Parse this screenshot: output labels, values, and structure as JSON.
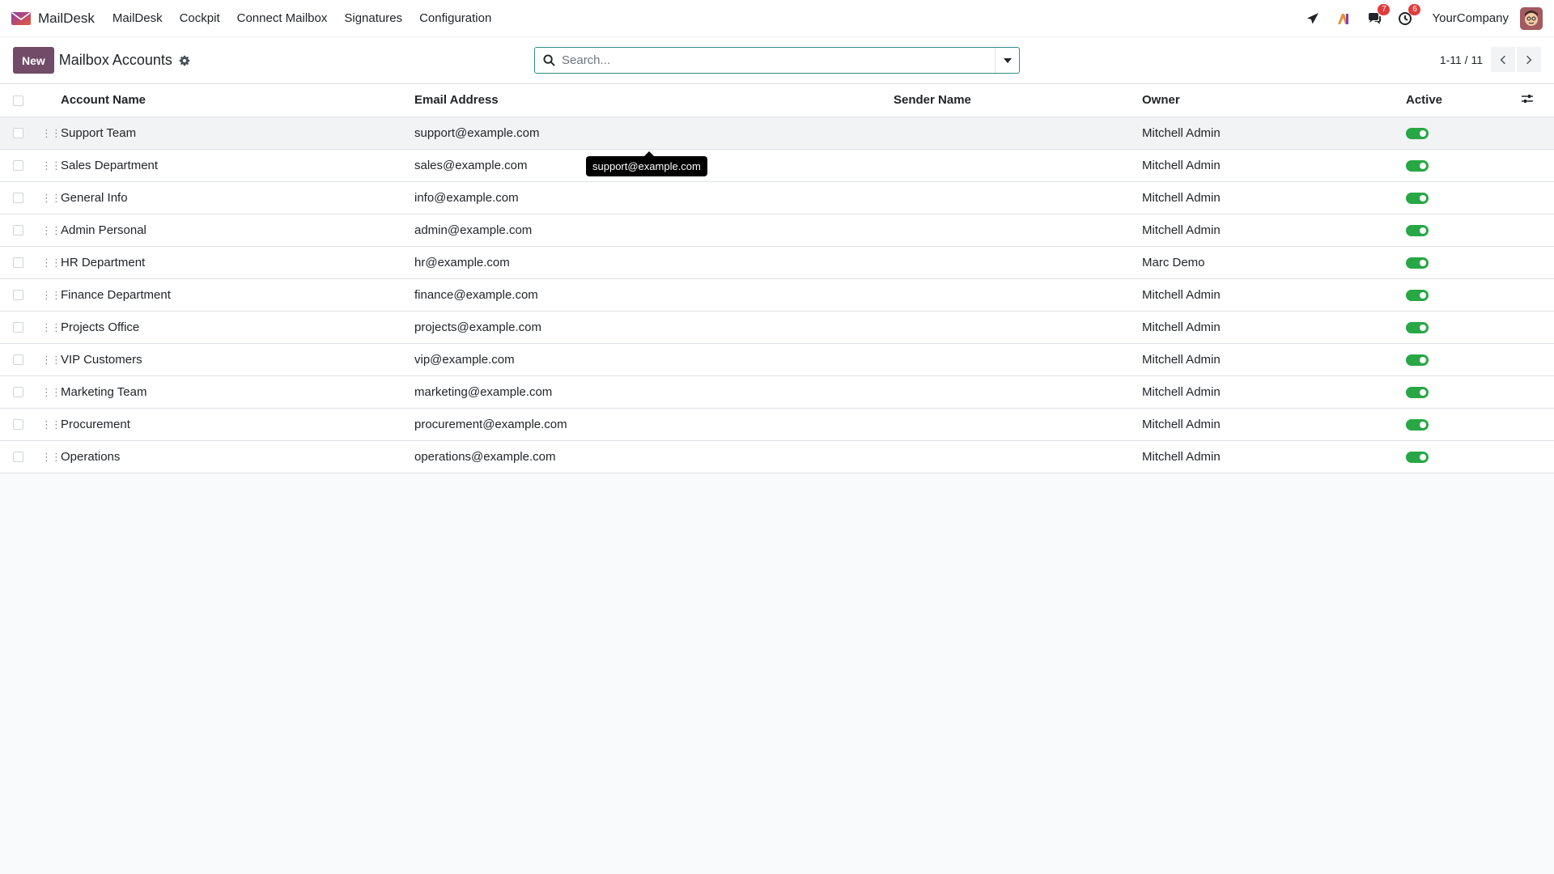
{
  "app": {
    "brand": "MailDesk",
    "menu": [
      "MailDesk",
      "Cockpit",
      "Connect Mailbox",
      "Signatures",
      "Configuration"
    ],
    "messages_count": "7",
    "activities_count": "6",
    "company": "YourCompany",
    "accent": "#714b67"
  },
  "control": {
    "new_label": "New",
    "title": "Mailbox Accounts",
    "search_placeholder": "Search...",
    "pager": "1-11 / 11"
  },
  "table": {
    "columns": {
      "account_name": "Account Name",
      "email": "Email Address",
      "sender": "Sender Name",
      "owner": "Owner",
      "active": "Active"
    },
    "rows": [
      {
        "account_name": "Support Team",
        "email": "support@example.com",
        "sender": "",
        "owner": "Mitchell Admin",
        "active": true
      },
      {
        "account_name": "Sales Department",
        "email": "sales@example.com",
        "sender": "",
        "owner": "Mitchell Admin",
        "active": true
      },
      {
        "account_name": "General Info",
        "email": "info@example.com",
        "sender": "",
        "owner": "Mitchell Admin",
        "active": true
      },
      {
        "account_name": "Admin Personal",
        "email": "admin@example.com",
        "sender": "",
        "owner": "Mitchell Admin",
        "active": true
      },
      {
        "account_name": "HR Department",
        "email": "hr@example.com",
        "sender": "",
        "owner": "Marc Demo",
        "active": true
      },
      {
        "account_name": "Finance Department",
        "email": "finance@example.com",
        "sender": "",
        "owner": "Mitchell Admin",
        "active": true
      },
      {
        "account_name": "Projects Office",
        "email": "projects@example.com",
        "sender": "",
        "owner": "Mitchell Admin",
        "active": true
      },
      {
        "account_name": "VIP Customers",
        "email": "vip@example.com",
        "sender": "",
        "owner": "Mitchell Admin",
        "active": true
      },
      {
        "account_name": "Marketing Team",
        "email": "marketing@example.com",
        "sender": "",
        "owner": "Mitchell Admin",
        "active": true
      },
      {
        "account_name": "Procurement",
        "email": "procurement@example.com",
        "sender": "",
        "owner": "Mitchell Admin",
        "active": true
      },
      {
        "account_name": "Operations",
        "email": "operations@example.com",
        "sender": "",
        "owner": "Mitchell Admin",
        "active": true
      }
    ]
  },
  "tooltip": {
    "text": "support@example.com"
  }
}
